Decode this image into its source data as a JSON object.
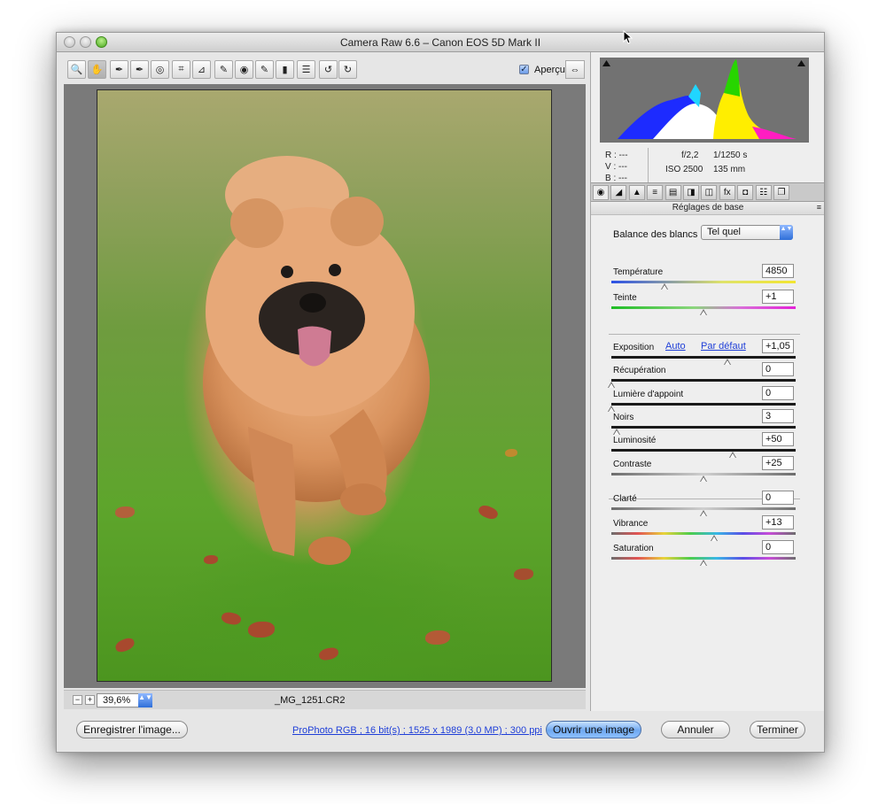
{
  "window": {
    "title": "Camera Raw 6.6  –  Canon EOS 5D Mark II"
  },
  "toolbar": {
    "tools": [
      {
        "name": "zoom-tool",
        "icon": "magnifier-icon",
        "glyph": "🔍"
      },
      {
        "name": "hand-tool",
        "icon": "hand-icon",
        "glyph": "✋"
      },
      {
        "name": "white-balance-tool",
        "icon": "eyedropper-icon",
        "glyph": "✒"
      },
      {
        "name": "color-sampler-tool",
        "icon": "eyedropper-plus-icon",
        "glyph": "✒"
      },
      {
        "name": "target-adjustment-tool",
        "icon": "target-icon",
        "glyph": "◎"
      },
      {
        "name": "crop-tool",
        "icon": "crop-icon",
        "glyph": "⌗"
      },
      {
        "name": "straighten-tool",
        "icon": "straighten-icon",
        "glyph": "⊿"
      },
      {
        "name": "spot-removal-tool",
        "icon": "brush-icon",
        "glyph": "✎"
      },
      {
        "name": "red-eye-tool",
        "icon": "eye-icon",
        "glyph": "◉"
      },
      {
        "name": "adjustment-brush-tool",
        "icon": "brush-icon",
        "glyph": "✎"
      },
      {
        "name": "graduated-filter-tool",
        "icon": "gradient-icon",
        "glyph": "▮"
      },
      {
        "name": "preferences-tool",
        "icon": "list-icon",
        "glyph": "☰"
      },
      {
        "name": "rotate-left-tool",
        "icon": "rotate-left-icon",
        "glyph": "↺"
      },
      {
        "name": "rotate-right-tool",
        "icon": "rotate-right-icon",
        "glyph": "↻"
      }
    ],
    "preview_label": "Aperçu",
    "preview_checked": "✓",
    "fullscreen_glyph": "⇔"
  },
  "statusbar": {
    "zoom_out": "−",
    "zoom_in": "+",
    "zoom_value": "39,6%",
    "stepper_glyph": "▲▼",
    "filename": "_MG_1251.CR2"
  },
  "readout": {
    "r": "R :   ---",
    "v": "V :   ---",
    "b": "B :   ---",
    "aperture": "f/2,2",
    "shutter": "1/1250 s",
    "iso": "ISO 2500",
    "focal": "135 mm"
  },
  "panel_tabs": [
    "◉",
    "◢",
    "▲",
    "≡",
    "▤",
    "◨",
    "◫",
    "fx",
    "◘",
    "☷",
    "❐"
  ],
  "panel": {
    "title": "Réglages de base",
    "menu_glyph": "≡",
    "wb_label": "Balance des blancs :",
    "wb_value": "Tel quel",
    "wb_arrows": "▲▼",
    "auto_link": "Auto",
    "default_link": "Par défaut"
  },
  "sliders": [
    {
      "label": "Température",
      "value": "4850",
      "pos": 0.29,
      "track": "temp"
    },
    {
      "label": "Teinte",
      "value": "+1",
      "pos": 0.5,
      "track": "tint"
    },
    {
      "label": "Exposition",
      "value": "+1,05",
      "pos": 0.63,
      "track": "dark"
    },
    {
      "label": "Récupération",
      "value": "0",
      "pos": 0.0,
      "track": "dark"
    },
    {
      "label": "Lumière d'appoint",
      "value": "0",
      "pos": 0.0,
      "track": "dark"
    },
    {
      "label": "Noirs",
      "value": "3",
      "pos": 0.03,
      "track": "dark"
    },
    {
      "label": "Luminosité",
      "value": "+50",
      "pos": 0.66,
      "track": "dark"
    },
    {
      "label": "Contraste",
      "value": "+25",
      "pos": 0.5,
      "track": "gray"
    },
    {
      "label": "Clarté",
      "value": "0",
      "pos": 0.5,
      "track": "gray"
    },
    {
      "label": "Vibrance",
      "value": "+13",
      "pos": 0.56,
      "track": "rainbow"
    },
    {
      "label": "Saturation",
      "value": "0",
      "pos": 0.5,
      "track": "rainbow"
    }
  ],
  "bottom": {
    "save": "Enregistrer l'image...",
    "info": "ProPhoto RGB ; 16 bit(s) ; 1525 x 1989 (3,0 MP) ; 300 ppi",
    "open": "Ouvrir une image",
    "cancel": "Annuler",
    "done": "Terminer"
  },
  "colors": {
    "accent": "#6fa8f0",
    "link": "#1f3fd8",
    "histogram_bg": "#727272"
  }
}
